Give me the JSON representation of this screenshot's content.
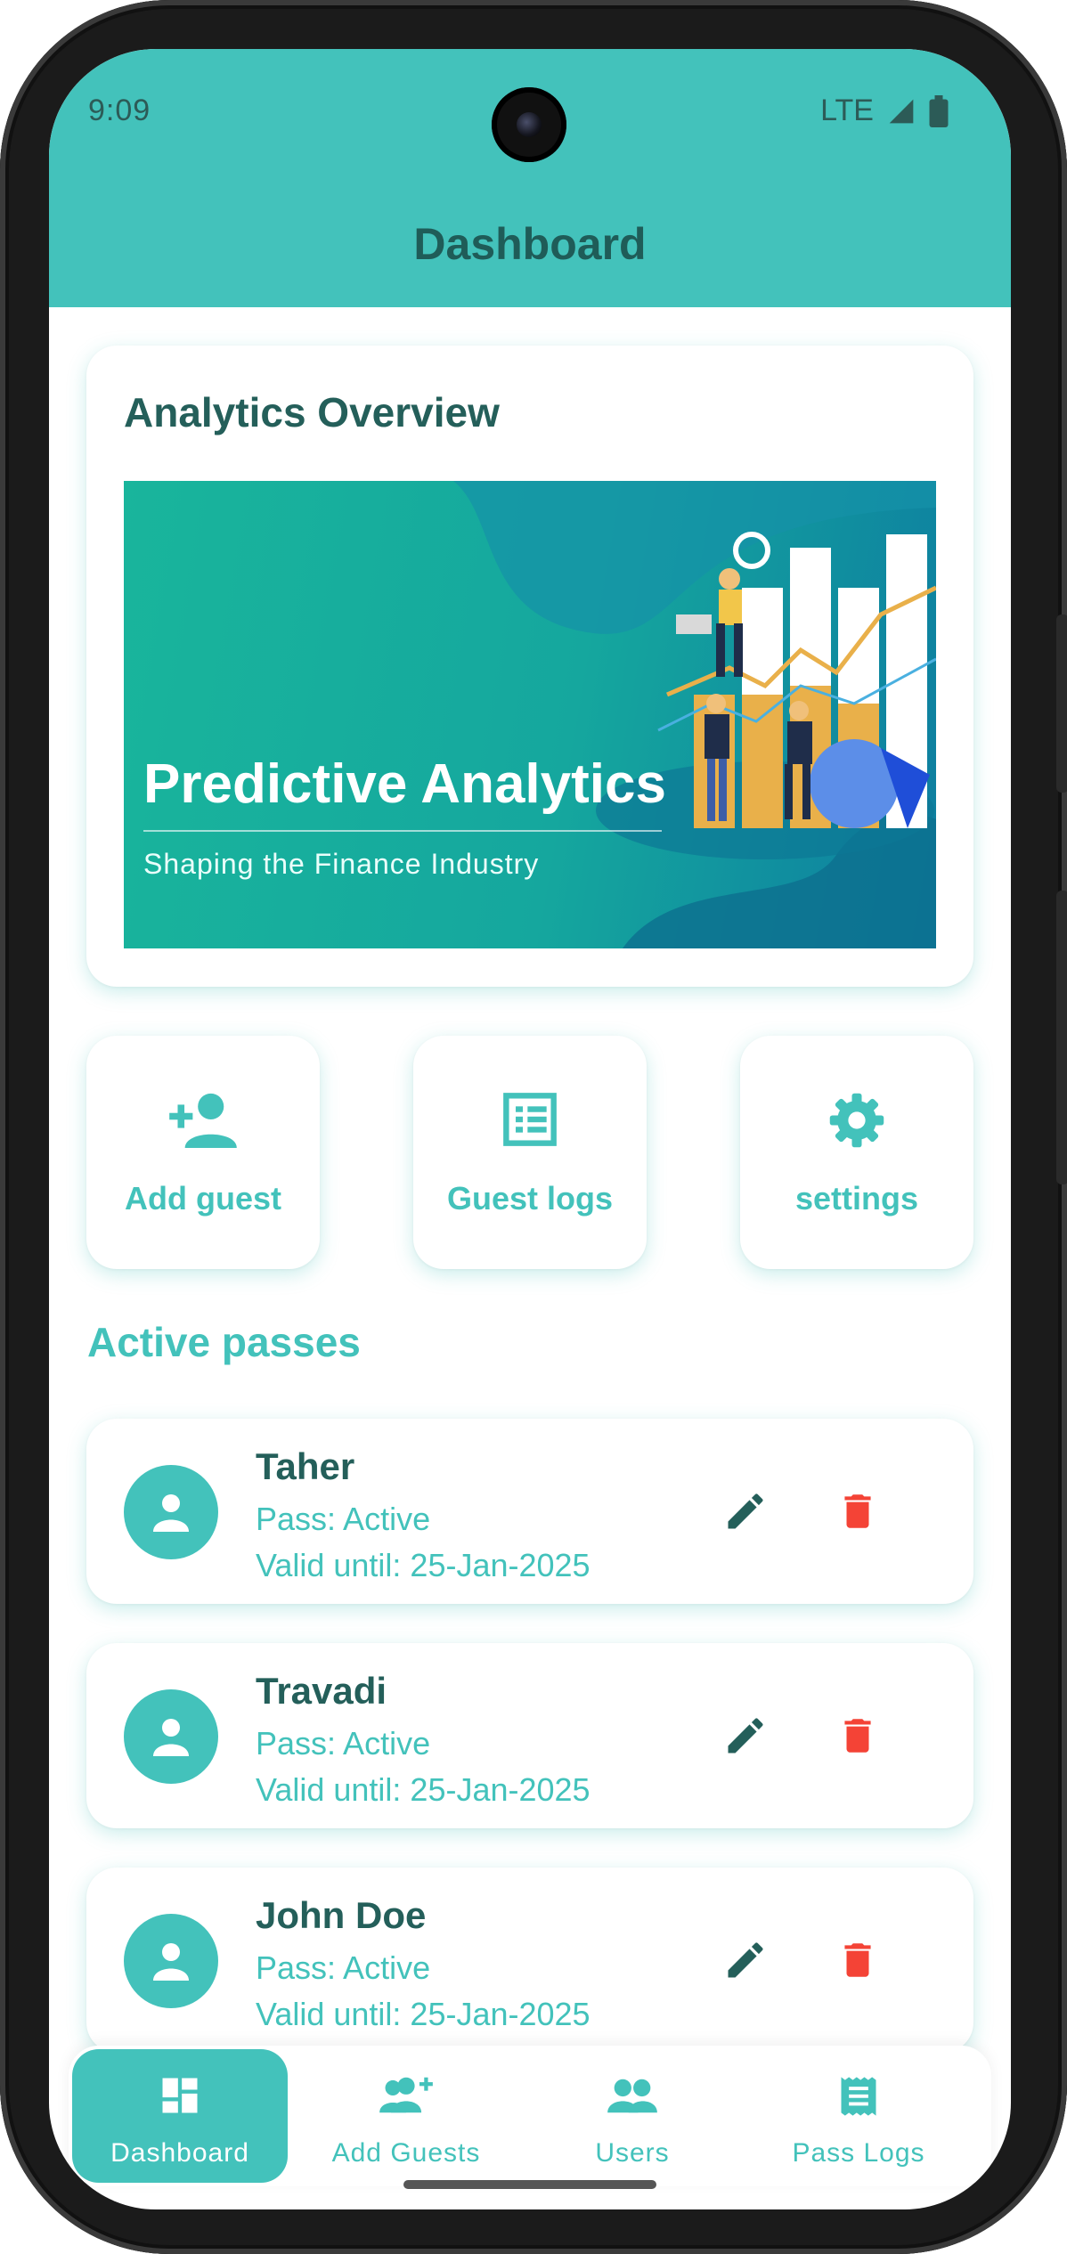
{
  "status_bar": {
    "time": "9:09",
    "network": "LTE"
  },
  "header": {
    "title": "Dashboard"
  },
  "analytics": {
    "title": "Analytics Overview",
    "banner_title": "Predictive Analytics",
    "banner_subtitle": "Shaping the Finance Industry"
  },
  "quick_actions": [
    {
      "label": "Add guest",
      "icon": "person-add-icon"
    },
    {
      "label": "Guest logs",
      "icon": "list-alt-icon"
    },
    {
      "label": "settings",
      "icon": "gear-icon"
    }
  ],
  "active_passes": {
    "title": "Active passes",
    "items": [
      {
        "name": "Taher",
        "status": "Pass: Active",
        "valid_until": "Valid until: 25-Jan-2025"
      },
      {
        "name": "Travadi",
        "status": "Pass: Active",
        "valid_until": "Valid until: 25-Jan-2025"
      },
      {
        "name": "John Doe",
        "status": "Pass: Active",
        "valid_until": "Valid until: 25-Jan-2025"
      }
    ]
  },
  "bottom_nav": [
    {
      "label": "Dashboard",
      "icon": "dashboard-icon",
      "active": true
    },
    {
      "label": "Add Guests",
      "icon": "group-add-icon",
      "active": false
    },
    {
      "label": "Users",
      "icon": "people-icon",
      "active": false
    },
    {
      "label": "Pass Logs",
      "icon": "receipt-icon",
      "active": false
    }
  ],
  "colors": {
    "primary": "#43c2bb",
    "dark_text": "#245f5a",
    "delete": "#f44336",
    "edit": "#245f5a"
  }
}
